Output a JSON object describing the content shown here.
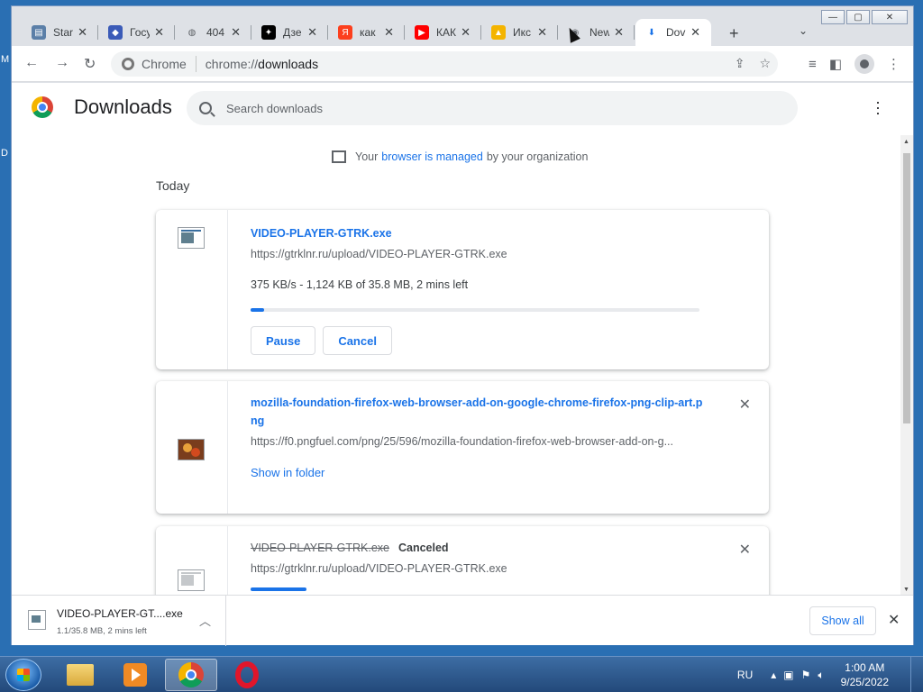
{
  "desktop": {
    "left_glyph_top": "M",
    "left_glyph_mid": "D"
  },
  "window": {
    "controls": {
      "minimize": "—",
      "maximize": "▢",
      "close": "✕"
    }
  },
  "tabs": [
    {
      "label": "Star",
      "icon": "document-icon",
      "color": "#5b7fa8"
    },
    {
      "label": "Госу",
      "icon": "gosuslugi-icon",
      "color": "#3b5bb8"
    },
    {
      "label": "404",
      "icon": "globe-icon",
      "color": "#5f6368"
    },
    {
      "label": "Дзе",
      "icon": "dzen-icon",
      "color": "#000000"
    },
    {
      "label": "как",
      "icon": "yandex-icon",
      "color": "#fc3f1d"
    },
    {
      "label": "КАК",
      "icon": "youtube-icon",
      "color": "#ff0000"
    },
    {
      "label": "Икс",
      "icon": "image-icon",
      "color": "#f4b400"
    },
    {
      "label": "New",
      "icon": "chrome-icon",
      "color": "#5f6368"
    },
    {
      "label": "Dov",
      "icon": "download-icon",
      "color": "#1a73e8"
    }
  ],
  "toolbar": {
    "site_label": "Chrome",
    "url_scheme": "chrome://",
    "url_path": "downloads"
  },
  "page": {
    "title": "Downloads",
    "search_placeholder": "Search downloads",
    "managed_prefix": "Your",
    "managed_link": "browser is managed",
    "managed_suffix": "by your organization",
    "section": "Today"
  },
  "downloads": [
    {
      "name": "VIDEO-PLAYER-GTRK.exe",
      "url": "https://gtrklnr.ru/upload/VIDEO-PLAYER-GTRK.exe",
      "status": "375 KB/s - 1,124 KB of 35.8 MB, 2 mins left",
      "progress": 0.03,
      "pause_label": "Pause",
      "cancel_label": "Cancel"
    },
    {
      "name": "mozilla-foundation-firefox-web-browser-add-on-google-chrome-firefox-png-clip-art.png",
      "url": "https://f0.pngfuel.com/png/25/596/mozilla-foundation-firefox-web-browser-add-on-g...",
      "action_label": "Show in folder"
    },
    {
      "name": "VIDEO-PLAYER-GTRK.exe",
      "state": "Canceled",
      "url": "https://gtrklnr.ru/upload/VIDEO-PLAYER-GTRK.exe"
    }
  ],
  "shelf": {
    "item_name": "VIDEO-PLAYER-GT....exe",
    "item_status": "1.1/35.8 MB, 2 mins left",
    "show_all": "Show all"
  },
  "taskbar": {
    "lang": "RU",
    "time": "1:00 AM",
    "date": "9/25/2022"
  }
}
